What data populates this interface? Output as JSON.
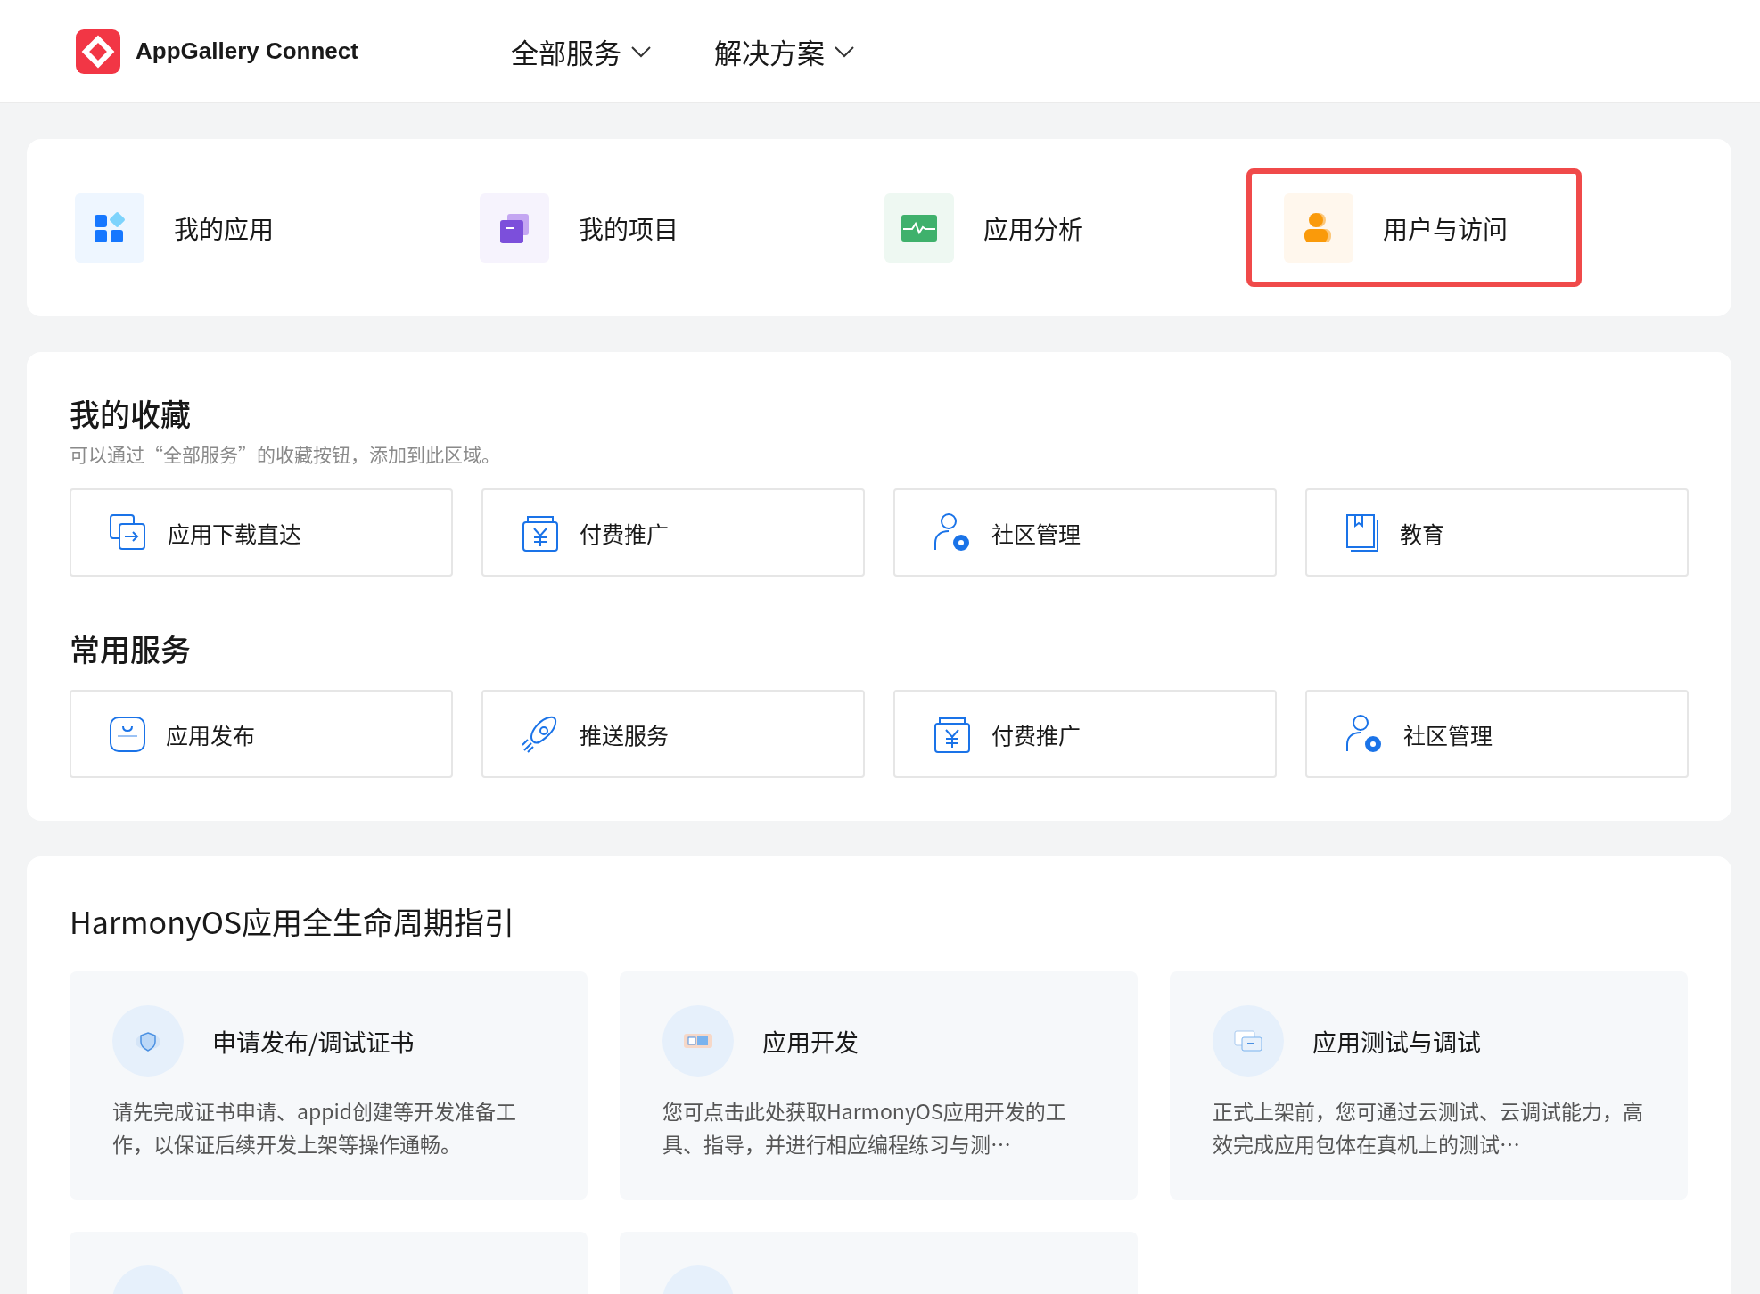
{
  "header": {
    "brand": "AppGallery Connect",
    "nav": [
      {
        "label": "全部服务",
        "expanded": false
      },
      {
        "label": "解决方案",
        "expanded": false
      }
    ]
  },
  "quick_links": [
    {
      "kind": "apps",
      "label": "我的应用",
      "highlighted": false
    },
    {
      "kind": "projects",
      "label": "我的项目",
      "highlighted": false
    },
    {
      "kind": "analytics",
      "label": "应用分析",
      "highlighted": false
    },
    {
      "kind": "users",
      "label": "用户与访问",
      "highlighted": true
    }
  ],
  "favorites": {
    "title": "我的收藏",
    "subtitle": "可以通过“全部服务”的收藏按钮，添加到此区域。",
    "items": [
      {
        "kind": "download",
        "label": "应用下载直达"
      },
      {
        "kind": "payment",
        "label": "付费推广"
      },
      {
        "kind": "community",
        "label": "社区管理"
      },
      {
        "kind": "education",
        "label": "教育"
      }
    ]
  },
  "common_services": {
    "title": "常用服务",
    "items": [
      {
        "kind": "publish",
        "label": "应用发布"
      },
      {
        "kind": "push",
        "label": "推送服务"
      },
      {
        "kind": "payment",
        "label": "付费推广"
      },
      {
        "kind": "community",
        "label": "社区管理"
      }
    ]
  },
  "lifecycle": {
    "title": "HarmonyOS应用全生命周期指引",
    "guides": [
      {
        "kind": "certificate",
        "title": "申请发布/调试证书",
        "description": "请先完成证书申请、appid创建等开发准备工作，以保证后续开发上架等操作通畅。"
      },
      {
        "kind": "develop",
        "title": "应用开发",
        "description": "您可点击此处获取HarmonyOS应用开发的工具、指导，并进行相应编程练习与测…"
      },
      {
        "kind": "test",
        "title": "应用测试与调试",
        "description": "正式上架前，您可通过云测试、云调试能力，高效完成应用包体在真机上的测试…"
      },
      {
        "kind": "partial"
      },
      {
        "kind": "partial"
      }
    ]
  }
}
